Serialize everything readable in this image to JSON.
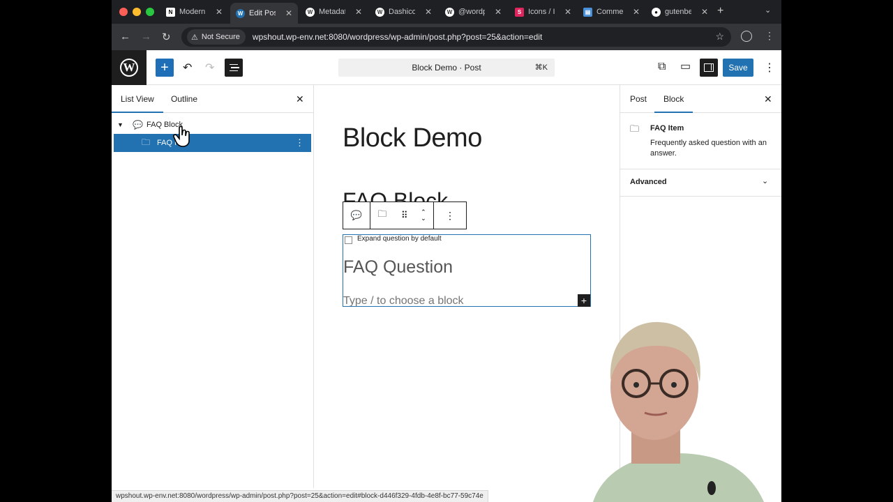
{
  "browser": {
    "tabs": [
      {
        "title": "Modern",
        "icon": "notion-icon",
        "color": "#ffffff"
      },
      {
        "title": "Edit Post",
        "icon": "wordpress-icon",
        "color": "#2271b1"
      },
      {
        "title": "Metadata",
        "icon": "wordpress-icon",
        "color": "#ffffff"
      },
      {
        "title": "Dashicons",
        "icon": "wordpress-icon",
        "color": "#ffffff"
      },
      {
        "title": "@wordpress",
        "icon": "wordpress-icon",
        "color": "#ffffff"
      },
      {
        "title": "Icons / Icons",
        "icon": "icons-icon",
        "color": "#e0245e"
      },
      {
        "title": "Comments",
        "icon": "comments-icon",
        "color": "#4a90d9"
      },
      {
        "title": "gutenberg",
        "icon": "github-icon",
        "color": "#ffffff"
      }
    ],
    "secure_label": "Not Secure",
    "url": "wpshout.wp-env.net:8080/wordpress/wp-admin/post.php?post=25&action=edit",
    "status_url": "wpshout.wp-env.net:8080/wordpress/wp-admin/post.php?post=25&action=edit#block-d446f329-4fdb-4e8f-bc77-59c74e"
  },
  "editor": {
    "command_label": "Block Demo · Post",
    "command_shortcut": "⌘K",
    "save_label": "Save",
    "accent": "#2271b1"
  },
  "list_panel": {
    "tabs": [
      "List View",
      "Outline"
    ],
    "tree": [
      {
        "label": "FAQ Block",
        "selected": false
      },
      {
        "label": "FAQ I",
        "selected": true
      }
    ]
  },
  "canvas": {
    "post_title": "Block Demo",
    "heading": "FAQ Block",
    "checkbox_label": "Expand question by default",
    "question": "FAQ Question",
    "placeholder": "Type / to choose a block"
  },
  "settings": {
    "tabs": [
      "Post",
      "Block"
    ],
    "block_name": "FAQ Item",
    "block_desc": "Frequently asked question with an answer.",
    "advanced_label": "Advanced"
  }
}
